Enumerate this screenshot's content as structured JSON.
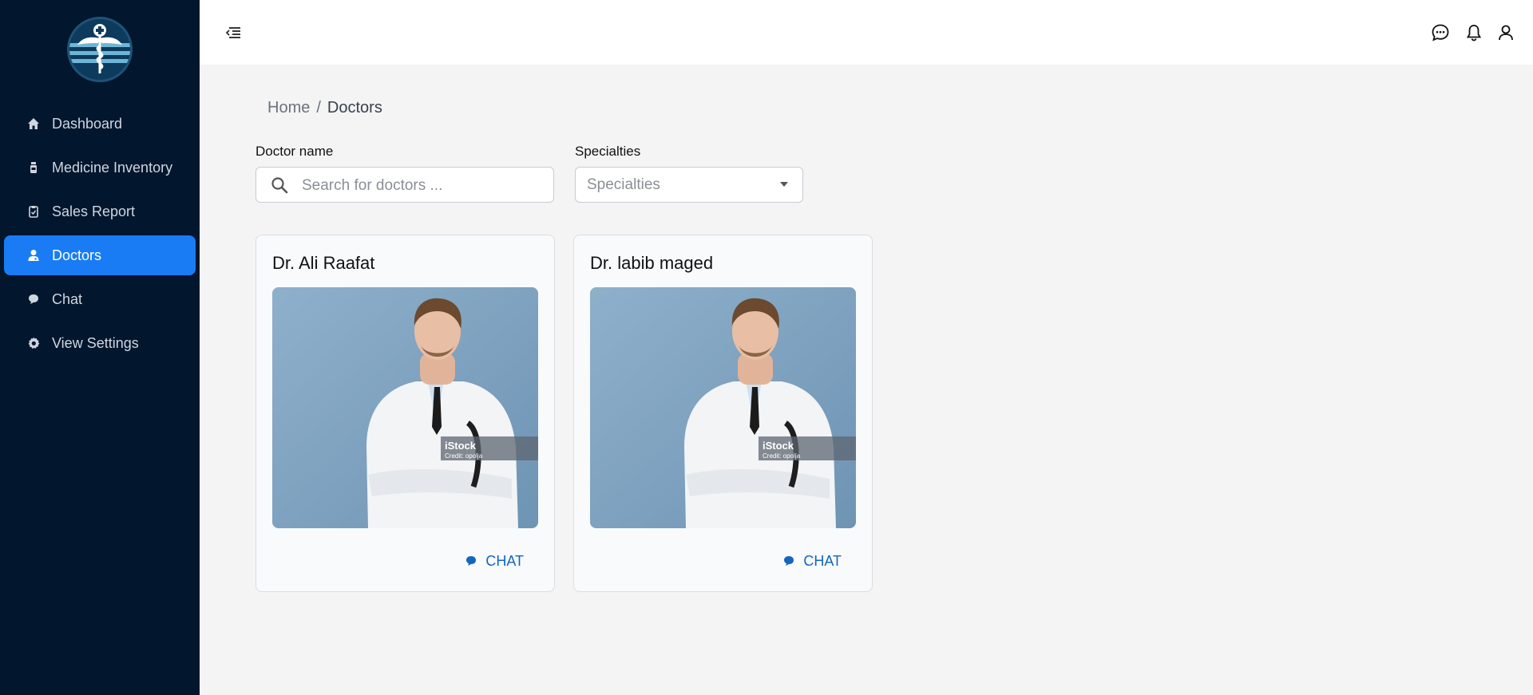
{
  "sidebar": {
    "items": [
      {
        "label": "Dashboard",
        "icon": "home-icon"
      },
      {
        "label": "Medicine Inventory",
        "icon": "medicine-bottle-icon"
      },
      {
        "label": "Sales Report",
        "icon": "clipboard-icon"
      },
      {
        "label": "Doctors",
        "icon": "doctor-icon",
        "active": true
      },
      {
        "label": "Chat",
        "icon": "chat-icon"
      },
      {
        "label": "View Settings",
        "icon": "gear-icon"
      }
    ]
  },
  "header": {
    "icons": [
      "menu-toggle-icon",
      "messages-icon",
      "bell-icon",
      "user-icon"
    ]
  },
  "breadcrumb": {
    "home": "Home",
    "separator": "/",
    "current": "Doctors"
  },
  "filters": {
    "doctor_name_label": "Doctor name",
    "search_placeholder": "Search for doctors ...",
    "specialties_label": "Specialties",
    "specialties_value": "Specialties"
  },
  "doctors": [
    {
      "name": "Dr. Ali Raafat",
      "chat_label": "CHAT",
      "watermark": "iStock",
      "credit": "Credit: opolja"
    },
    {
      "name": "Dr. labib maged",
      "chat_label": "CHAT",
      "watermark": "iStock",
      "credit": "Credit: opolja"
    }
  ],
  "colors": {
    "sidebar_bg": "#02162e",
    "active_item": "#1a7cf4",
    "chat_link": "#1565c0",
    "page_bg": "#f4f4f4"
  }
}
